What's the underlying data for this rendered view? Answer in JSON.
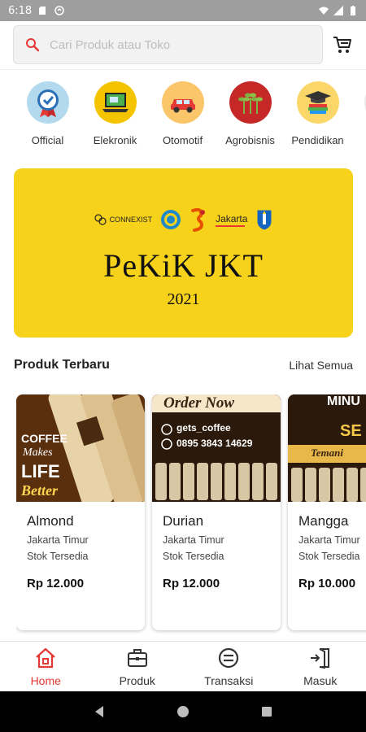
{
  "status_bar": {
    "time": "6:18"
  },
  "search": {
    "placeholder": "Cari Produk atau Toko"
  },
  "categories": [
    {
      "label": "Official",
      "icon": "official-badge-icon",
      "bg": "#b3d9ef"
    },
    {
      "label": "Elekronik",
      "icon": "laptop-icon",
      "bg": "#f5c400"
    },
    {
      "label": "Otomotif",
      "icon": "car-icon",
      "bg": "#fbc56a"
    },
    {
      "label": "Agrobisnis",
      "icon": "sprout-icon",
      "bg": "#c62828"
    },
    {
      "label": "Pendidikan",
      "icon": "graduation-cap-icon",
      "bg": "#fbd76a"
    }
  ],
  "banner": {
    "title": "PeKiK JKT",
    "year": "2021",
    "logo_connexist": "CONNEXIST",
    "logo_jakarta": "Jakarta",
    "bg": "#f7d21b"
  },
  "section": {
    "title": "Produk Terbaru",
    "more": "Lihat Semua"
  },
  "products": [
    {
      "name": "Almond",
      "location": "Jakarta Timur",
      "stock": "Stok Tersedia",
      "price": "Rp 12.000",
      "img_text_1": "COFFEE",
      "img_text_2": "Makes",
      "img_text_3": "LIFE",
      "img_text_4": "Better"
    },
    {
      "name": "Durian",
      "location": "Jakarta Timur",
      "stock": "Stok Tersedia",
      "price": "Rp 12.000",
      "img_text_1": "Order Now",
      "img_text_2": "gets_coffee",
      "img_text_3": "0895 3843 14629"
    },
    {
      "name": "Mangga",
      "location": "Jakarta Timur",
      "stock": "Stok Tersedia",
      "price": "Rp 10.000",
      "img_text_1": "MINU",
      "img_text_2": "SE",
      "img_text_3": "Temani"
    }
  ],
  "bottom_nav": [
    {
      "label": "Home",
      "icon": "home-icon",
      "active": true
    },
    {
      "label": "Produk",
      "icon": "briefcase-icon",
      "active": false
    },
    {
      "label": "Transaksi",
      "icon": "equals-circle-icon",
      "active": false
    },
    {
      "label": "Masuk",
      "icon": "login-icon",
      "active": false
    }
  ],
  "colors": {
    "accent": "#e53935",
    "banner": "#f7d21b"
  }
}
